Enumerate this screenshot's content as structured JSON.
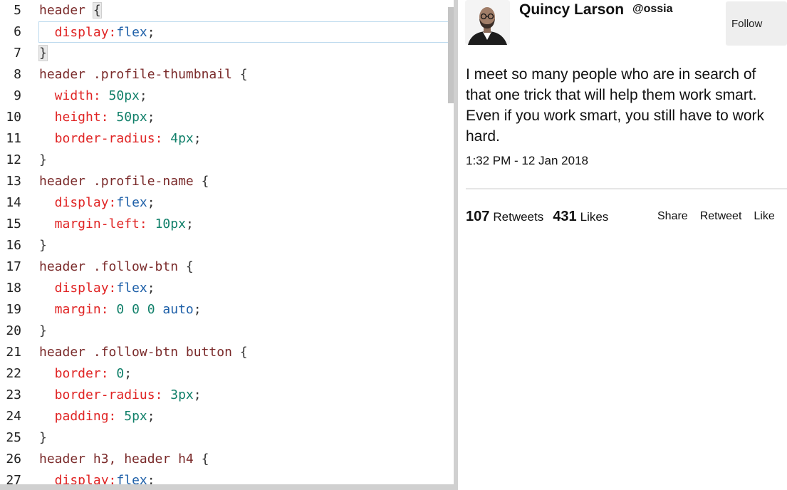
{
  "editor": {
    "lines": [
      {
        "n": "5",
        "tokens": [
          {
            "t": "header ",
            "c": "sel"
          },
          {
            "t": "{",
            "c": "brace"
          }
        ]
      },
      {
        "n": "6",
        "active": true,
        "tokens": [
          {
            "t": "  display",
            "c": "prop"
          },
          {
            "t": ":",
            "c": "prop"
          },
          {
            "t": "flex",
            "c": "val"
          },
          {
            "t": ";",
            "c": "punc"
          }
        ]
      },
      {
        "n": "7",
        "tokens": [
          {
            "t": "}",
            "c": "brace"
          }
        ]
      },
      {
        "n": "8",
        "tokens": [
          {
            "t": "header .profile-thumbnail ",
            "c": "sel"
          },
          {
            "t": "{",
            "c": "punc"
          }
        ]
      },
      {
        "n": "9",
        "tokens": [
          {
            "t": "  width",
            "c": "prop"
          },
          {
            "t": ": ",
            "c": "prop"
          },
          {
            "t": "50px",
            "c": "num"
          },
          {
            "t": ";",
            "c": "punc"
          }
        ]
      },
      {
        "n": "10",
        "tokens": [
          {
            "t": "  height",
            "c": "prop"
          },
          {
            "t": ": ",
            "c": "prop"
          },
          {
            "t": "50px",
            "c": "num"
          },
          {
            "t": ";",
            "c": "punc"
          }
        ]
      },
      {
        "n": "11",
        "tokens": [
          {
            "t": "  border-radius",
            "c": "prop"
          },
          {
            "t": ": ",
            "c": "prop"
          },
          {
            "t": "4px",
            "c": "num"
          },
          {
            "t": ";",
            "c": "punc"
          }
        ]
      },
      {
        "n": "12",
        "tokens": [
          {
            "t": "}",
            "c": "punc"
          }
        ]
      },
      {
        "n": "13",
        "tokens": [
          {
            "t": "header .profile-name ",
            "c": "sel"
          },
          {
            "t": "{",
            "c": "punc"
          }
        ]
      },
      {
        "n": "14",
        "tokens": [
          {
            "t": "  display",
            "c": "prop"
          },
          {
            "t": ":",
            "c": "prop"
          },
          {
            "t": "flex",
            "c": "val"
          },
          {
            "t": ";",
            "c": "punc"
          }
        ]
      },
      {
        "n": "15",
        "tokens": [
          {
            "t": "  margin-left",
            "c": "prop"
          },
          {
            "t": ": ",
            "c": "prop"
          },
          {
            "t": "10px",
            "c": "num"
          },
          {
            "t": ";",
            "c": "punc"
          }
        ]
      },
      {
        "n": "16",
        "tokens": [
          {
            "t": "}",
            "c": "punc"
          }
        ]
      },
      {
        "n": "17",
        "tokens": [
          {
            "t": "header .follow-btn ",
            "c": "sel"
          },
          {
            "t": "{",
            "c": "punc"
          }
        ]
      },
      {
        "n": "18",
        "tokens": [
          {
            "t": "  display",
            "c": "prop"
          },
          {
            "t": ":",
            "c": "prop"
          },
          {
            "t": "flex",
            "c": "val"
          },
          {
            "t": ";",
            "c": "punc"
          }
        ]
      },
      {
        "n": "19",
        "tokens": [
          {
            "t": "  margin",
            "c": "prop"
          },
          {
            "t": ": ",
            "c": "prop"
          },
          {
            "t": "0 0 0 ",
            "c": "num"
          },
          {
            "t": "auto",
            "c": "val"
          },
          {
            "t": ";",
            "c": "punc"
          }
        ]
      },
      {
        "n": "20",
        "tokens": [
          {
            "t": "}",
            "c": "punc"
          }
        ]
      },
      {
        "n": "21",
        "tokens": [
          {
            "t": "header .follow-btn button ",
            "c": "sel"
          },
          {
            "t": "{",
            "c": "punc"
          }
        ]
      },
      {
        "n": "22",
        "tokens": [
          {
            "t": "  border",
            "c": "prop"
          },
          {
            "t": ": ",
            "c": "prop"
          },
          {
            "t": "0",
            "c": "num"
          },
          {
            "t": ";",
            "c": "punc"
          }
        ]
      },
      {
        "n": "23",
        "tokens": [
          {
            "t": "  border-radius",
            "c": "prop"
          },
          {
            "t": ": ",
            "c": "prop"
          },
          {
            "t": "3px",
            "c": "num"
          },
          {
            "t": ";",
            "c": "punc"
          }
        ]
      },
      {
        "n": "24",
        "tokens": [
          {
            "t": "  padding",
            "c": "prop"
          },
          {
            "t": ": ",
            "c": "prop"
          },
          {
            "t": "5px",
            "c": "num"
          },
          {
            "t": ";",
            "c": "punc"
          }
        ]
      },
      {
        "n": "25",
        "tokens": [
          {
            "t": "}",
            "c": "punc"
          }
        ]
      },
      {
        "n": "26",
        "tokens": [
          {
            "t": "header h3, header h4 ",
            "c": "sel"
          },
          {
            "t": "{",
            "c": "punc"
          }
        ]
      },
      {
        "n": "27",
        "tokens": [
          {
            "t": "  display",
            "c": "prop"
          },
          {
            "t": ":",
            "c": "prop"
          },
          {
            "t": "flex",
            "c": "val"
          },
          {
            "t": ";",
            "c": "punc"
          }
        ]
      }
    ]
  },
  "preview": {
    "profile_name": "Quincy Larson",
    "profile_handle": "@ossia",
    "follow_label": "Follow",
    "tweet_text": "I meet so many people who are in search of that one trick that will help them work smart. Even if you work smart, you still have to work hard.",
    "tweet_date": "1:32 PM - 12 Jan 2018",
    "retweets_count": "107",
    "retweets_label": "Retweets",
    "likes_count": "431",
    "likes_label": "Likes",
    "actions": {
      "share": "Share",
      "retweet": "Retweet",
      "like": "Like"
    }
  },
  "colors": {
    "selector": "#7a2a2a",
    "property": "#e02424",
    "keyword_value": "#1d5fa8",
    "number_value": "#11806a",
    "active_line_border": "#bcd9ee"
  }
}
